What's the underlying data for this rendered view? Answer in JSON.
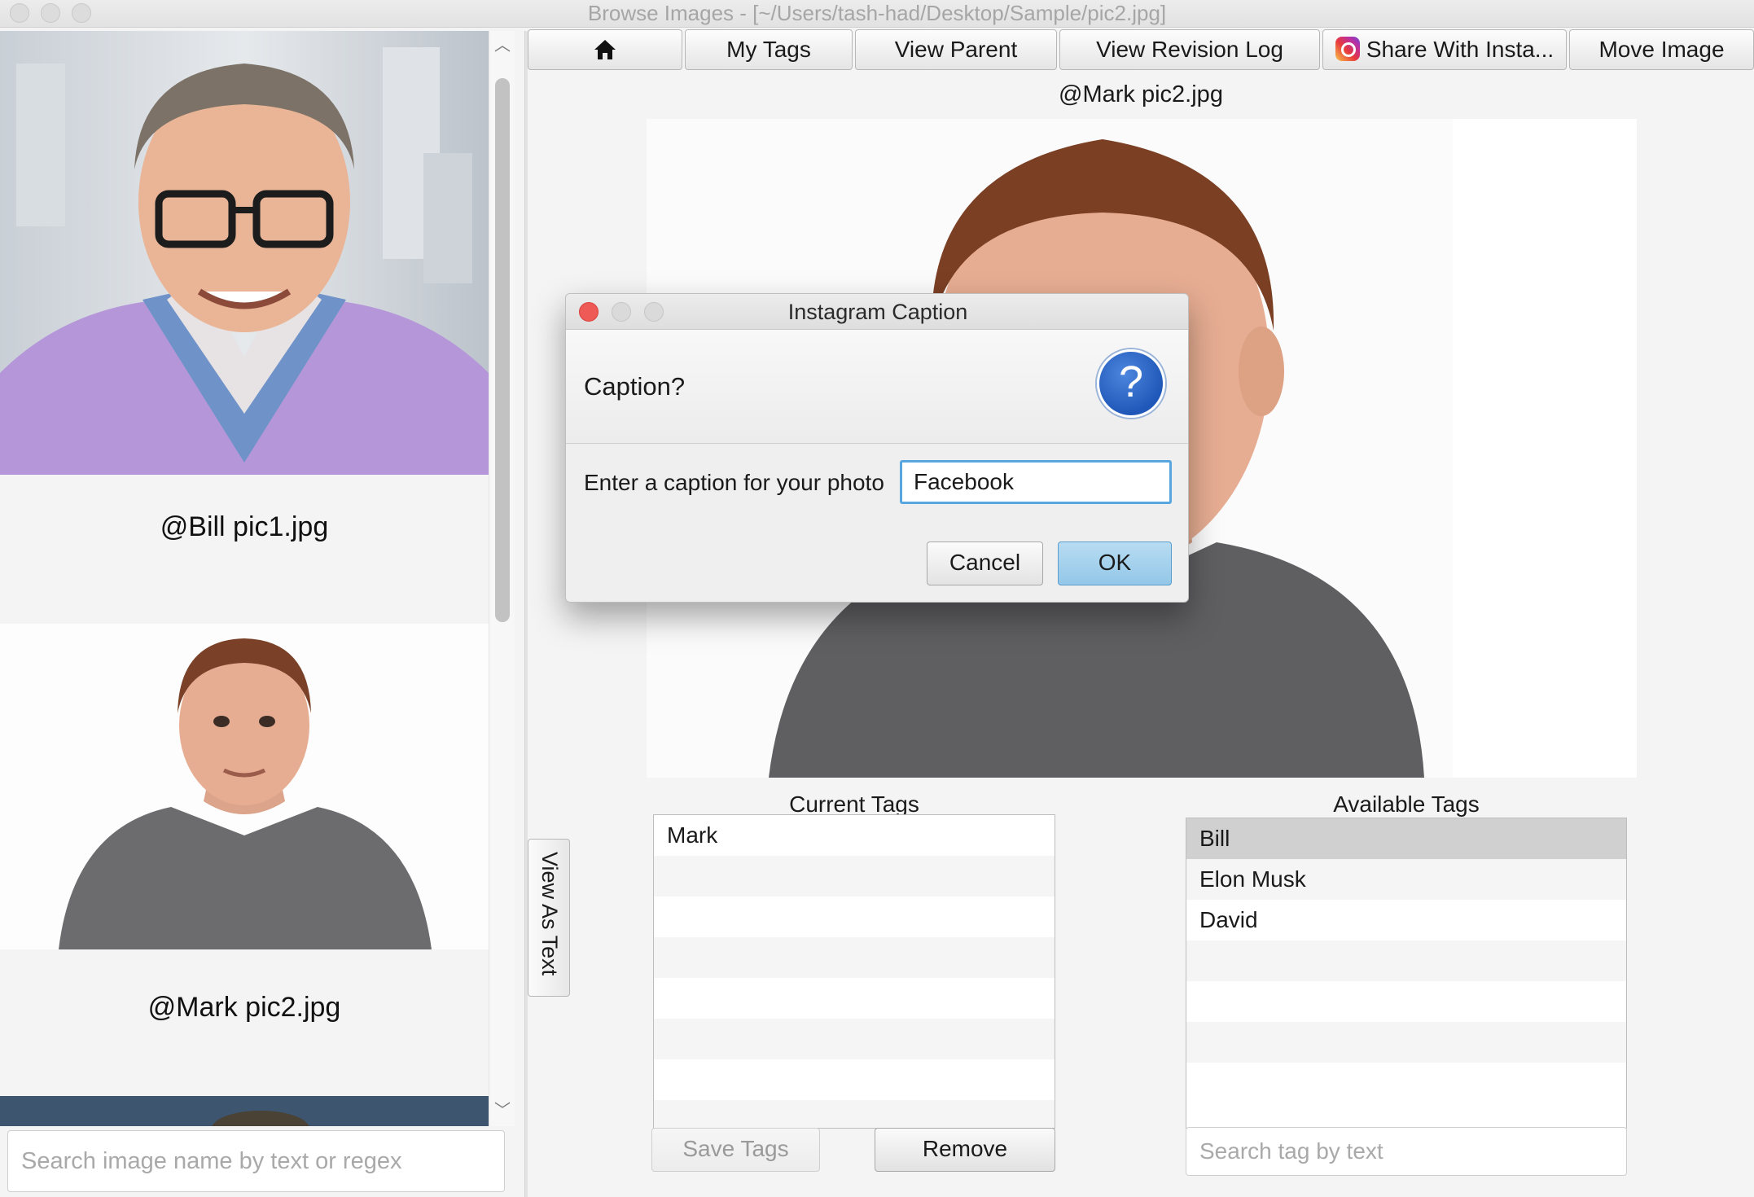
{
  "window": {
    "title": "Browse Images - [~/Users/tash-had/Desktop/Sample/pic2.jpg]"
  },
  "gallery": {
    "items": [
      {
        "caption": "@Bill pic1.jpg"
      },
      {
        "caption": "@Mark pic2.jpg"
      }
    ],
    "search_placeholder": "Search image name by text or regex"
  },
  "toolbar": {
    "home_icon": "home-icon",
    "my_tags": "My Tags",
    "view_parent": "View Parent",
    "view_revision_log": "View Revision Log",
    "share_instagram": "Share With Insta...",
    "move_image": "Move Image"
  },
  "viewer": {
    "image_title": "@Mark pic2.jpg",
    "view_as_text": "View As Text"
  },
  "tags": {
    "current_header": "Current Tags",
    "current": [
      "Mark"
    ],
    "available_header": "Available Tags",
    "available": [
      "Bill",
      "Elon Musk",
      "David"
    ],
    "selected_available": "Bill",
    "save_label": "Save Tags",
    "remove_label": "Remove",
    "search_placeholder": "Search tag by text"
  },
  "dialog": {
    "title": "Instagram Caption",
    "header": "Caption?",
    "prompt": "Enter a caption for your photo",
    "input_value": "Facebook",
    "cancel": "Cancel",
    "ok": "OK",
    "icon": "question-icon"
  },
  "colors": {
    "dialog_focus": "#58a6e0",
    "ok_button": "#a6d2ee",
    "close_dot": "#ee5a55",
    "help_icon": "#2a64c2"
  }
}
